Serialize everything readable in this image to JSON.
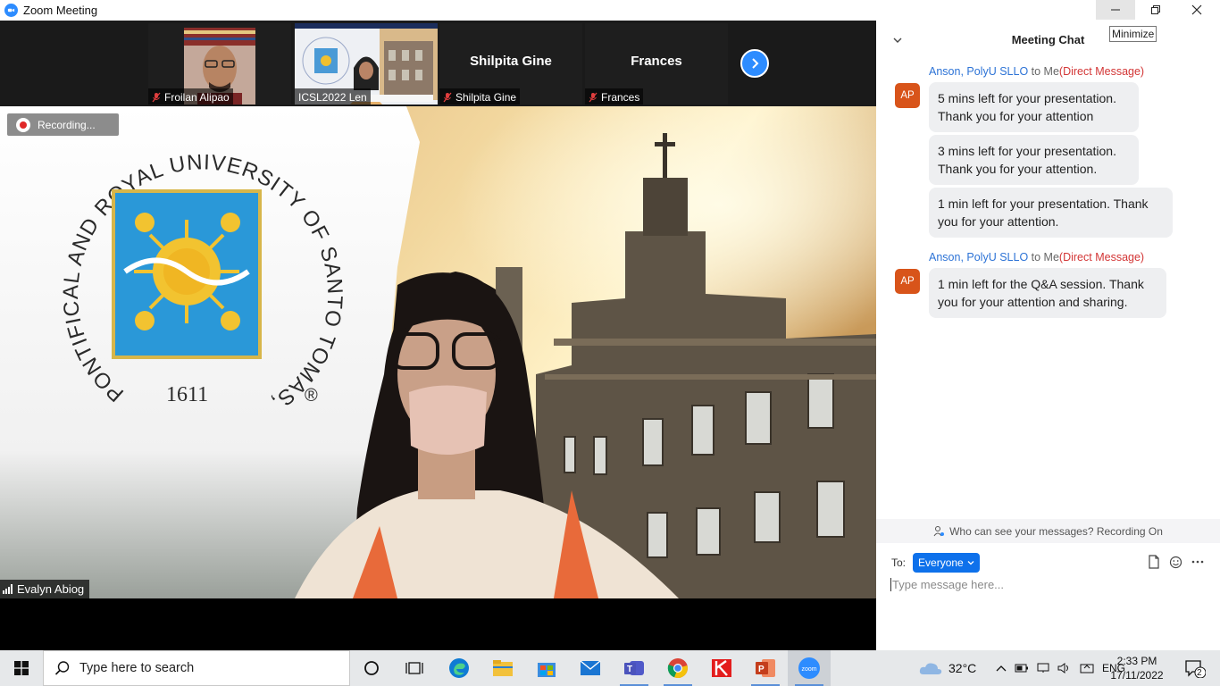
{
  "window": {
    "title": "Zoom Meeting",
    "tooltip": "Minimize"
  },
  "participants": [
    {
      "name": "Froilan Alipao",
      "muted": true,
      "has_video": true
    },
    {
      "name": "ICSL2022 Len",
      "muted": false,
      "has_video": true,
      "active": true
    },
    {
      "name": "Shilpita Gine",
      "display_name": "Shilpita Gine",
      "muted": true,
      "has_video": false
    },
    {
      "name": "Frances",
      "display_name": "Frances",
      "muted": true,
      "has_video": false
    }
  ],
  "main_video": {
    "recording_label": "Recording...",
    "speaker_name": "Evalyn Abiog",
    "background": {
      "seal_text": "PONTIFICAL AND ROYAL UNIVERSITY OF SANTO TOMAS, MANILA",
      "seal_year": "1611",
      "registered_mark": "®"
    }
  },
  "chat": {
    "title": "Meeting Chat",
    "groups": [
      {
        "sender": "Anson, PolyU SLLO",
        "to_text": "to Me",
        "dm_label": "(Direct Message)",
        "avatar": "AP",
        "messages": [
          "5 mins left for your presentation. Thank you for your attention",
          "3 mins left for your presentation. Thank you for your attention.",
          "1 min left for your presentation. Thank you for your attention."
        ]
      },
      {
        "sender": "Anson, PolyU SLLO",
        "to_text": "to Me",
        "dm_label": "(Direct Message)",
        "avatar": "AP",
        "messages": [
          "1 min left for the Q&A session. Thank you for your attention and sharing."
        ]
      }
    ],
    "privacy_note": "Who can see your messages? Recording On",
    "to_label": "To:",
    "recipient": "Everyone",
    "input_placeholder": "Type message here..."
  },
  "taskbar": {
    "search_placeholder": "Type here to search",
    "weather": "32°C",
    "language": "ENG",
    "time": "2:33 PM",
    "date": "17/11/2022",
    "notification_count": "2",
    "apps": [
      "cortana-icon",
      "task-view-icon",
      "edge-icon",
      "file-explorer-icon",
      "store-icon",
      "mail-icon",
      "teams-icon",
      "chrome-icon",
      "kaspersky-icon",
      "powerpoint-icon",
      "zoom-icon"
    ]
  },
  "colors": {
    "zoom_blue": "#2d8cff",
    "dm_red": "#d33636",
    "sender_blue": "#2d73d6",
    "avatar": "#d8541a"
  }
}
